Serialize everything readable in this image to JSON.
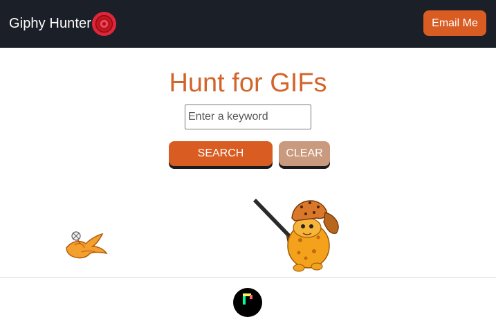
{
  "navbar": {
    "brand_name": "Giphy Hunter",
    "logo_icon": "target-icon",
    "email_button_label": "Email Me"
  },
  "main": {
    "title": "Hunt for GIFs",
    "search": {
      "placeholder": "Enter a keyword",
      "value": ""
    },
    "search_button_label": "SEARCH",
    "clear_button_label": "CLEAR"
  },
  "results": [
    {
      "icon": "flying-bird-gif"
    },
    {
      "icon": "hunter-with-rifle-gif"
    }
  ],
  "footer": {
    "logo_icon": "giphy-logo-icon"
  },
  "colors": {
    "navbar_bg": "#1b1f28",
    "accent": "#d95c22",
    "title": "#d2652b",
    "clear_button": "#c99a7e"
  }
}
